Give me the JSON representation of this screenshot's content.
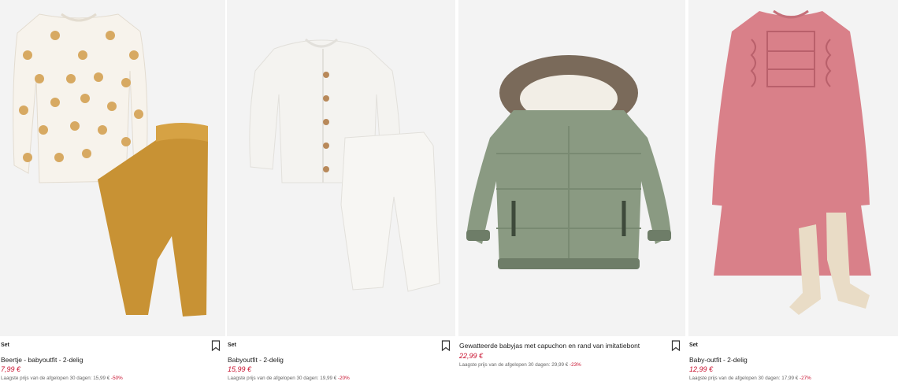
{
  "products": [
    {
      "badge": "Set",
      "title": "Beertje - babyoutfit - 2-delig",
      "price": "7,99 €",
      "lowest_text": "Laagste prijs van de afgelopen 30 dagen: 15,99 €",
      "discount": "-50%",
      "bookmark_icon": "bookmark-icon"
    },
    {
      "badge": "Set",
      "title": "Babyoutfit - 2-delig",
      "price": "15,99 €",
      "lowest_text": "Laagste prijs van de afgelopen 30 dagen: 19,99 €",
      "discount": "-20%",
      "bookmark_icon": "bookmark-icon"
    },
    {
      "badge": "",
      "title": "Gewatteerde babyjas met capuchon en rand van imitatiebont",
      "price": "22,99 €",
      "lowest_text": "Laagste prijs van de afgelopen 30 dagen: 29,99 €",
      "discount": "-23%",
      "bookmark_icon": "bookmark-icon"
    },
    {
      "badge": "Set",
      "title": "Baby-outfit - 2-delig",
      "price": "12,99 €",
      "lowest_text": "Laagste prijs van de afgelopen 30 dagen: 17,99 €",
      "discount": "-27%",
      "bookmark_icon": ""
    }
  ],
  "colors": {
    "price_red": "#c8102e",
    "image_bg": "#f3f3f3",
    "mustard": "#c89234",
    "cream": "#f7f3ec",
    "sage": "#8a9a82",
    "fur": "#7a6a5a",
    "pink": "#d98089",
    "oatmeal": "#e9dcc6"
  }
}
